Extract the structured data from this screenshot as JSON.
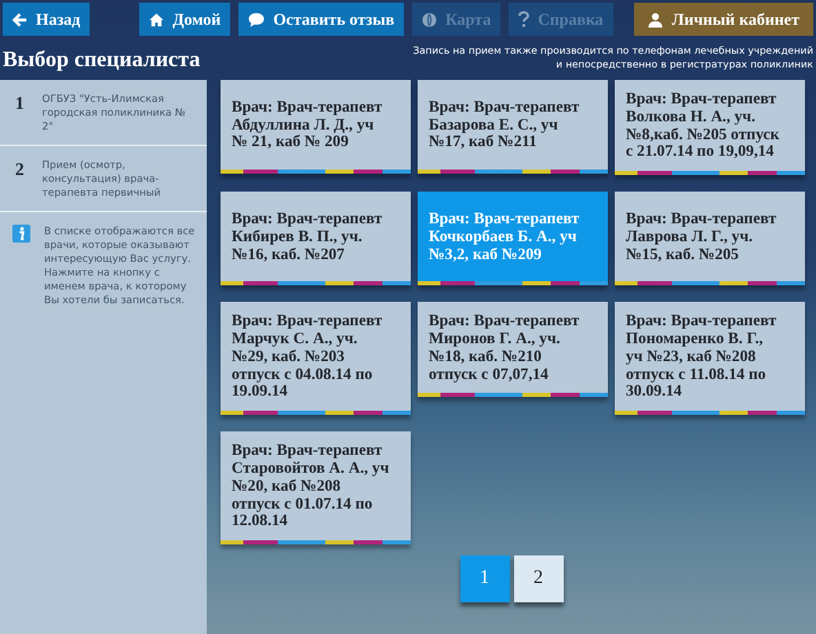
{
  "toolbar": [
    {
      "label": "Назад",
      "kind": "back",
      "disabled": false
    },
    {
      "label": "Домой",
      "kind": "home",
      "disabled": false
    },
    {
      "label": "Оставить отзыв",
      "kind": "feedback",
      "disabled": false
    },
    {
      "label": "Карта",
      "kind": "map",
      "disabled": true
    },
    {
      "label": "Справка",
      "kind": "help",
      "disabled": true
    },
    {
      "label": "Личный кабинет",
      "kind": "account",
      "disabled": false
    }
  ],
  "page_title": "Выбор специалиста",
  "notice": [
    "Запись на прием также производится по телефонам лечебных учреждений",
    "и непосредственно в регистратурах поликлиник"
  ],
  "steps": [
    {
      "number": "1",
      "text": "ОГБУЗ \"Усть-Илимская городская поликлиника № 2\""
    },
    {
      "number": "2",
      "text": "Прием (осмотр, консультация) врача-терапевта первичный"
    }
  ],
  "info": "В списке отображаются все врачи, которые оказывают интересующую Вас услугу. Нажмите на кнопку с именем врача, к которому Вы хотели бы записаться.",
  "doctors": [
    {
      "lines": [
        "Врач: Врач-терапевт",
        "Абдуллина Л. Д., уч",
        "№ 21, каб № 209"
      ],
      "selected": false
    },
    {
      "lines": [
        "Врач: Врач-терапевт",
        "Базарова Е. С., уч",
        "№17, каб №211"
      ],
      "selected": false
    },
    {
      "lines": [
        "Врач: Врач-терапевт",
        "Волкова Н. А., уч.",
        "№8,каб. №205 отпуск",
        "с 21.07.14 по 19,09,14"
      ],
      "selected": false
    },
    {
      "lines": [
        "Врач: Врач-терапевт",
        "Кибирев В. П., уч.",
        "№16, каб. №207"
      ],
      "selected": false
    },
    {
      "lines": [
        "Врач: Врач-терапевт",
        "Кочкорбаев Б. А., уч",
        "№3,2, каб №209"
      ],
      "selected": true
    },
    {
      "lines": [
        "Врач: Врач-терапевт",
        "Лаврова Л. Г., уч.",
        "№15, каб. №205"
      ],
      "selected": false
    },
    {
      "lines": [
        "Врач: Врач-терапевт",
        "Марчук С. А., уч.",
        "№29, каб. №203",
        "отпуск с 04.08.14 по",
        "19.09.14"
      ],
      "selected": false
    },
    {
      "lines": [
        "Врач: Врач-терапевт",
        "Миронов Г. А., уч.",
        "№18, каб. №210",
        "отпуск с 07,07,14"
      ],
      "selected": false
    },
    {
      "lines": [
        "Врач: Врач-терапевт",
        "Пономаренко В. Г.,",
        "уч №23, каб №208",
        "отпуск с 11.08.14 по",
        "30.09.14"
      ],
      "selected": false
    },
    {
      "lines": [
        "Врач: Врач-терапевт",
        "Старовойтов А. А., уч",
        "№20, каб №208",
        "отпуск с 01.07.14 по",
        "12.08.14"
      ],
      "selected": false
    }
  ],
  "pages": [
    {
      "label": "1",
      "selected": true
    },
    {
      "label": "2",
      "selected": false
    }
  ]
}
